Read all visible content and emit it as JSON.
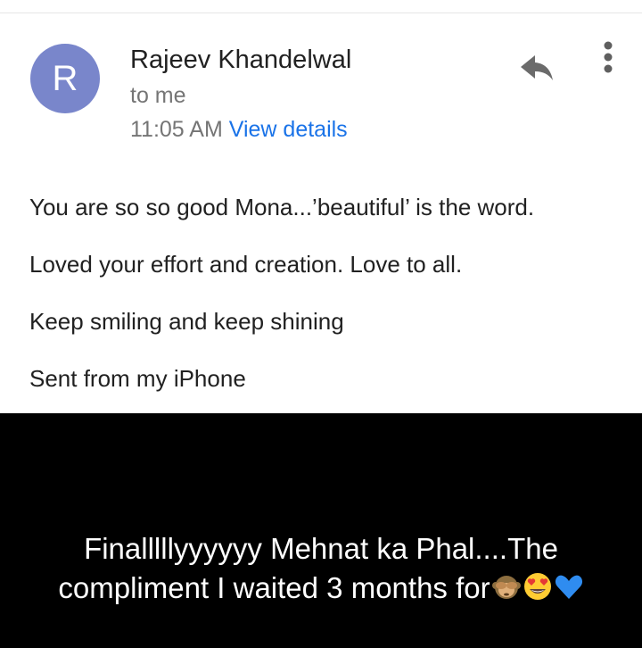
{
  "email": {
    "avatar_letter": "R",
    "sender_name": "Rajeev Khandelwal",
    "recipient": "to me",
    "time": "11:05 AM",
    "view_details": "View details",
    "body": [
      "You are so so good Mona...’beautiful’ is the word.",
      "Loved your effort and creation. Love to all.",
      "Keep smiling and keep shining",
      "Sent from my iPhone"
    ],
    "icons": {
      "reply": "reply-icon",
      "more": "more-vertical-icon"
    },
    "colors": {
      "avatar_bg": "#7986cb",
      "link": "#1a73e8",
      "secondary_text": "#757575"
    }
  },
  "caption": {
    "text": "Finalllllyyyyyy Mehnat ka Phal....The compliment I waited 3 months for",
    "emojis": [
      "see-no-evil-monkey",
      "heart-eyes-face",
      "blue-heart"
    ]
  }
}
